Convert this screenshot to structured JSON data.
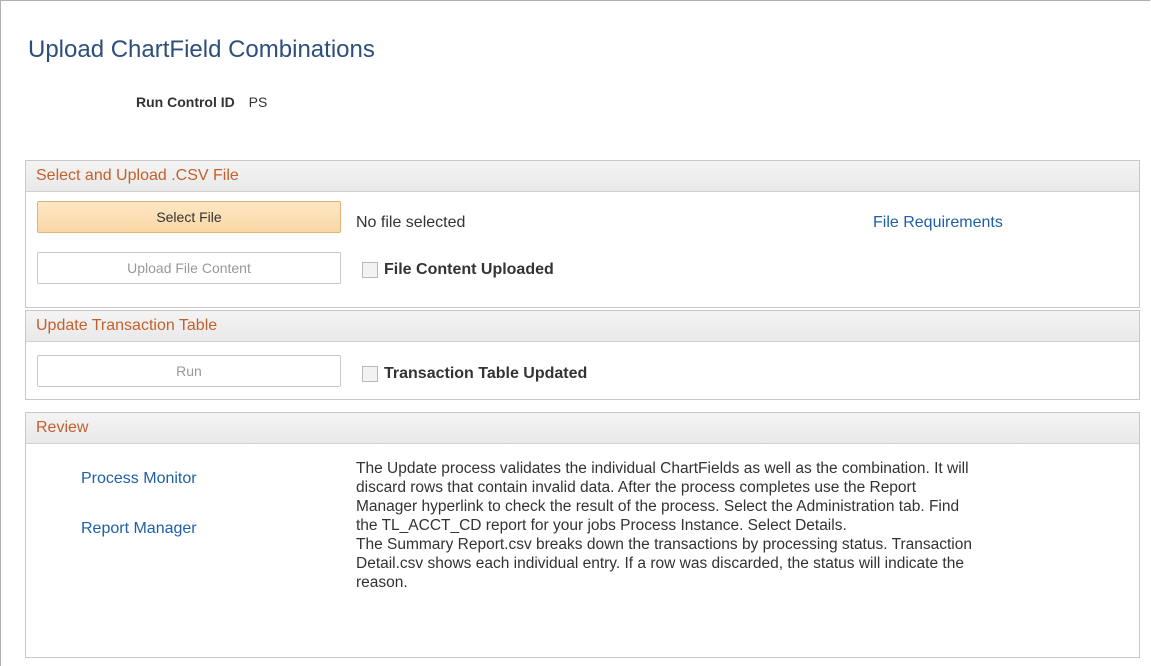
{
  "page": {
    "title": "Upload ChartField Combinations",
    "run_control_label": "Run Control ID",
    "run_control_value": "PS"
  },
  "sections": {
    "upload": {
      "header": "Select and Upload .CSV File",
      "select_file_button": "Select File",
      "no_file_text": "No file selected",
      "file_requirements_link": "File Requirements",
      "upload_button": "Upload File Content",
      "uploaded_checkbox_label": "File Content Uploaded",
      "uploaded_checked": false
    },
    "update": {
      "header": "Update Transaction Table",
      "run_button": "Run",
      "updated_checkbox_label": "Transaction Table Updated",
      "updated_checked": false
    },
    "review": {
      "header": "Review",
      "process_monitor_link": "Process Monitor",
      "report_manager_link": "Report Manager",
      "description_p1": "The Update process validates the individual ChartFields as well as the combination. It will discard rows that contain invalid data. After the process completes use the Report Manager hyperlink to check the result of the process. Select the Administration tab. Find the TL_ACCT_CD report for your jobs Process Instance. Select Details.",
      "description_p2": "The Summary Report.csv breaks down the transactions by processing status. Transaction Detail.csv shows each individual entry. If a row was discarded, the status will indicate the reason."
    }
  },
  "colors": {
    "title": "#2d4f7c",
    "section_header": "#c4602b",
    "link": "#1f5fa6",
    "primary_button": "#f8d7a4"
  }
}
